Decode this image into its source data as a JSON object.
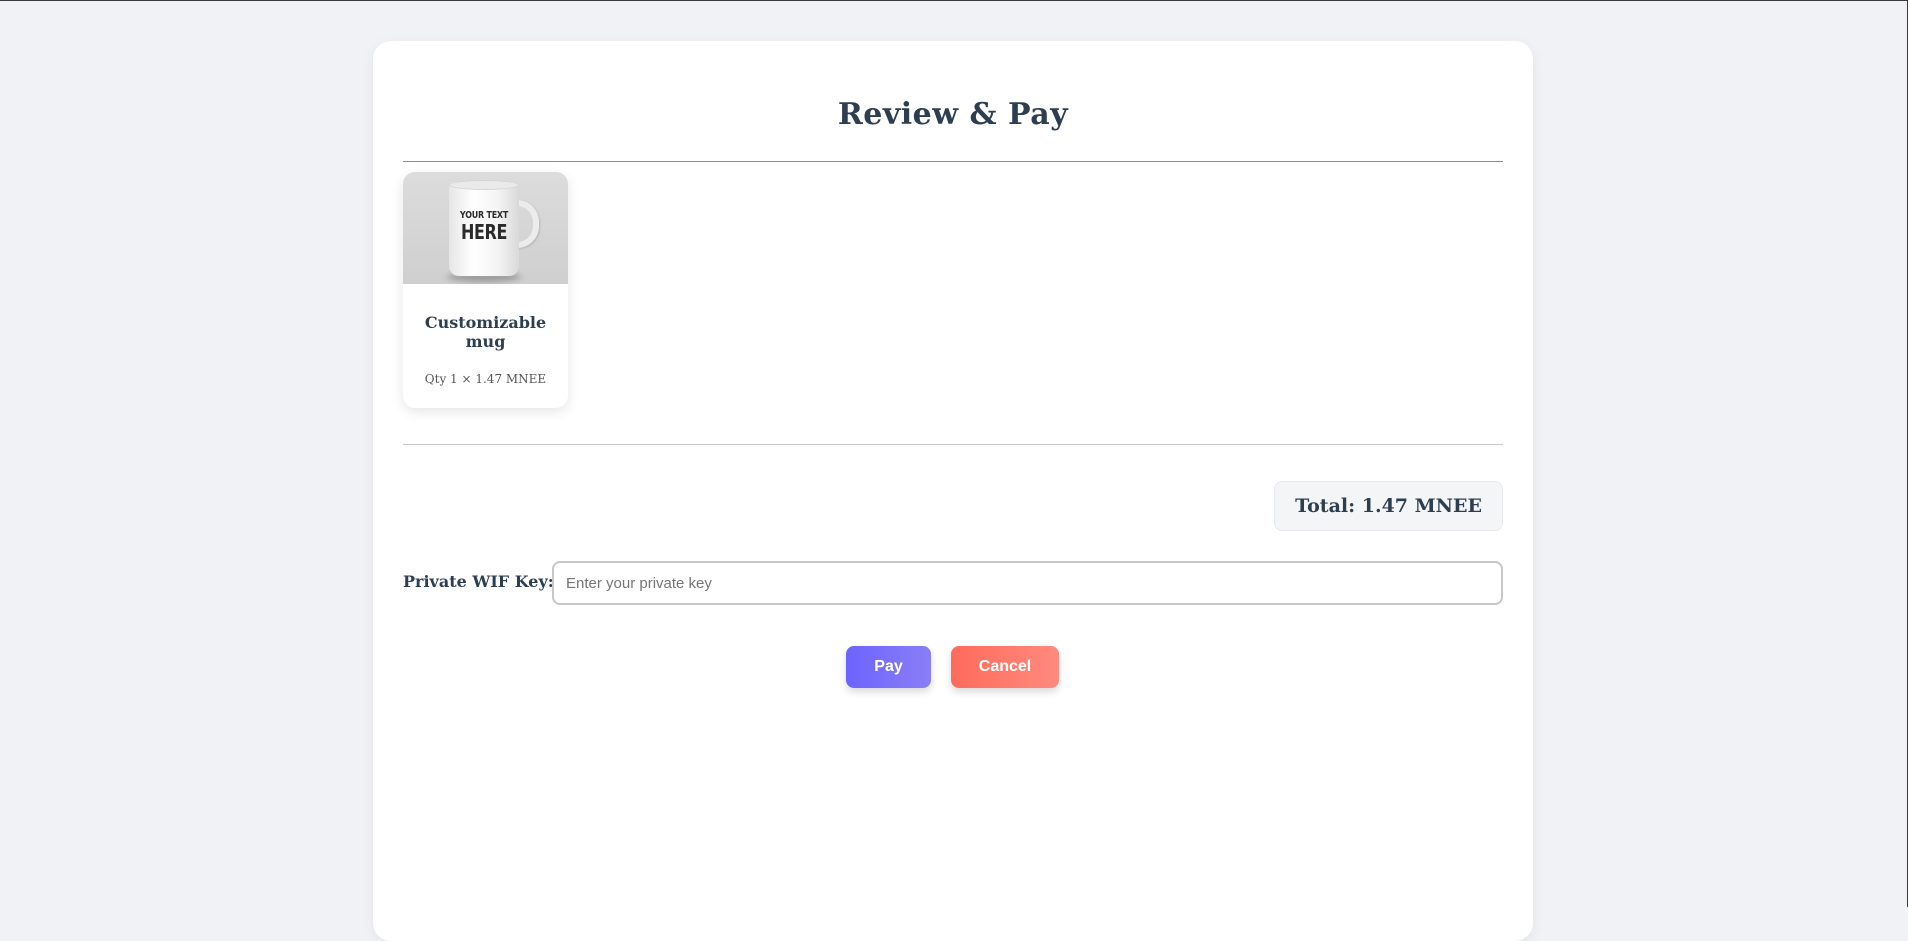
{
  "page": {
    "title": "Review & Pay"
  },
  "cart": {
    "items": [
      {
        "name": "Customizable mug",
        "qty_text": "Qty 1 × 1.47 MNEE",
        "image": {
          "icon": "mug-product-image",
          "text_line1": "YOUR TEXT",
          "text_line2": "HERE"
        }
      }
    ]
  },
  "summary": {
    "total_text": "Total: 1.47 MNEE"
  },
  "wif": {
    "label": "Private WIF Key:",
    "value": "",
    "placeholder": "Enter your private key"
  },
  "actions": {
    "pay_label": "Pay",
    "cancel_label": "Cancel"
  },
  "colors": {
    "background": "#f1f2f6",
    "card": "#ffffff",
    "heading": "#2c3e50",
    "pay_button": "#6c63ff",
    "cancel_button": "#ff6b5b"
  }
}
